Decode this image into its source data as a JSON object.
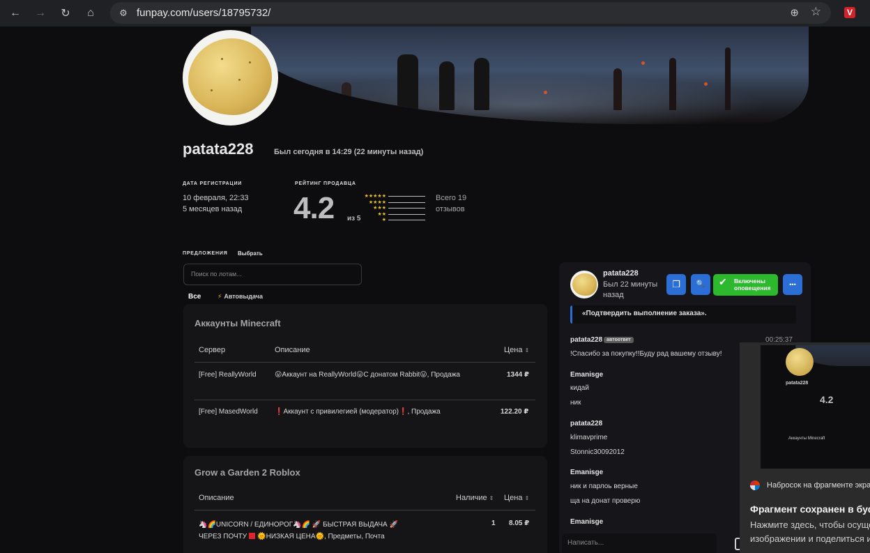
{
  "browser": {
    "url": "funpay.com/users/18795732/",
    "back_icon": "←",
    "forward_icon": "→",
    "reload_icon": "↻",
    "home_icon": "⌂",
    "tune_icon": "⚙",
    "zoom_icon": "⊕",
    "star_icon": "☆",
    "extension_label": "V"
  },
  "profile": {
    "username": "patata228",
    "last_seen": "Был сегодня в 14:29 (22 минуты назад)",
    "reg_label": "ДАТА РЕГИСТРАЦИИ",
    "reg_date": "10 февраля, 22:33",
    "reg_ago": "5 месяцев назад",
    "rating_label": "РЕЙТИНГ ПРОДАВЦА",
    "rating": "4.2",
    "rating_of": "из 5",
    "stars": [
      "★★★★★",
      "★★★★",
      "★★★",
      "★★",
      "★"
    ],
    "reviews_total": "Всего 19",
    "reviews_word": "отзывов"
  },
  "offers": {
    "label": "ПРЕДЛОЖЕНИЯ",
    "choose": "Выбрать",
    "search_placeholder": "Поиск по лотам...",
    "filter_all": "Все",
    "filter_auto": "Автовыдача",
    "bolt_icon": "⚡",
    "sort_icon": "⇕"
  },
  "minecraft": {
    "title": "Аккаунты Minecraft",
    "headers": {
      "server": "Сервер",
      "description": "Описание",
      "price": "Цена"
    },
    "rows": [
      {
        "server": "[Free] ReallyWorld",
        "description": "😛Аккаунт на ReallyWorld😛С донатом Rabbit😛, Продажа",
        "price": "1344 ₽"
      },
      {
        "server": "[Free] MasedWorld",
        "desc_mark": "❗",
        "desc_text": "Аккаунт с привилегией (модератор)",
        "desc_tail": ", Продажа",
        "price": "122.20 ₽"
      }
    ]
  },
  "garden": {
    "title": "Grow a Garden 2 Roblox",
    "headers": {
      "description": "Описание",
      "stock": "Наличие",
      "price": "Цена"
    },
    "row": {
      "line1": "🦄🌈UNICORN / ЕДИНОРОГ🦄🌈 🚀 БЫСТРАЯ ВЫДАЧА 🚀",
      "line2a": "ЧЕРЕЗ ПОЧТУ",
      "line2b": "🌞НИЗКАЯ ЦЕНА🌞, Предметы, Почта",
      "stock": "1",
      "price": "8.05 ₽"
    }
  },
  "chat": {
    "name": "patata228",
    "status": "Был 22 минуты назад",
    "copy_icon": "❐",
    "search_icon": "🔍",
    "notif_check": "✔",
    "notif_line1": "Включены",
    "notif_line2": "оповещения",
    "more_icon": "•••",
    "quote": "«Подтвердить выполнение заказа».",
    "msg1_author": "patata228",
    "msg1_tag": "автоответ",
    "msg1_time": "00:25:37",
    "msg1_text": "!Спасибо за покупку!!Буду рад вашему отзыву!",
    "msg2_author": "Emanisge",
    "msg2_lines": [
      "кидай",
      "ник"
    ],
    "msg3_author": "patata228",
    "msg3_lines": [
      "klimavprime",
      "Stonnic30092012"
    ],
    "msg4_author": "Emanisge",
    "msg4_lines": [
      "ник и парлоь верные",
      "ща на донат проверю"
    ],
    "msg5_author": "Emanisge",
    "input_placeholder": "Написать..."
  },
  "toast": {
    "app_name": "Набросок на фрагменте экрана",
    "title": "Фрагмент сохранен в буфер обмена",
    "body1": "Нажмите здесь, чтобы осуществить разметку",
    "body2": "изображении и поделиться им",
    "thumb_username": "patata228",
    "thumb_rating": "4.2",
    "thumb_section": "Аккаунты Minecraft"
  }
}
